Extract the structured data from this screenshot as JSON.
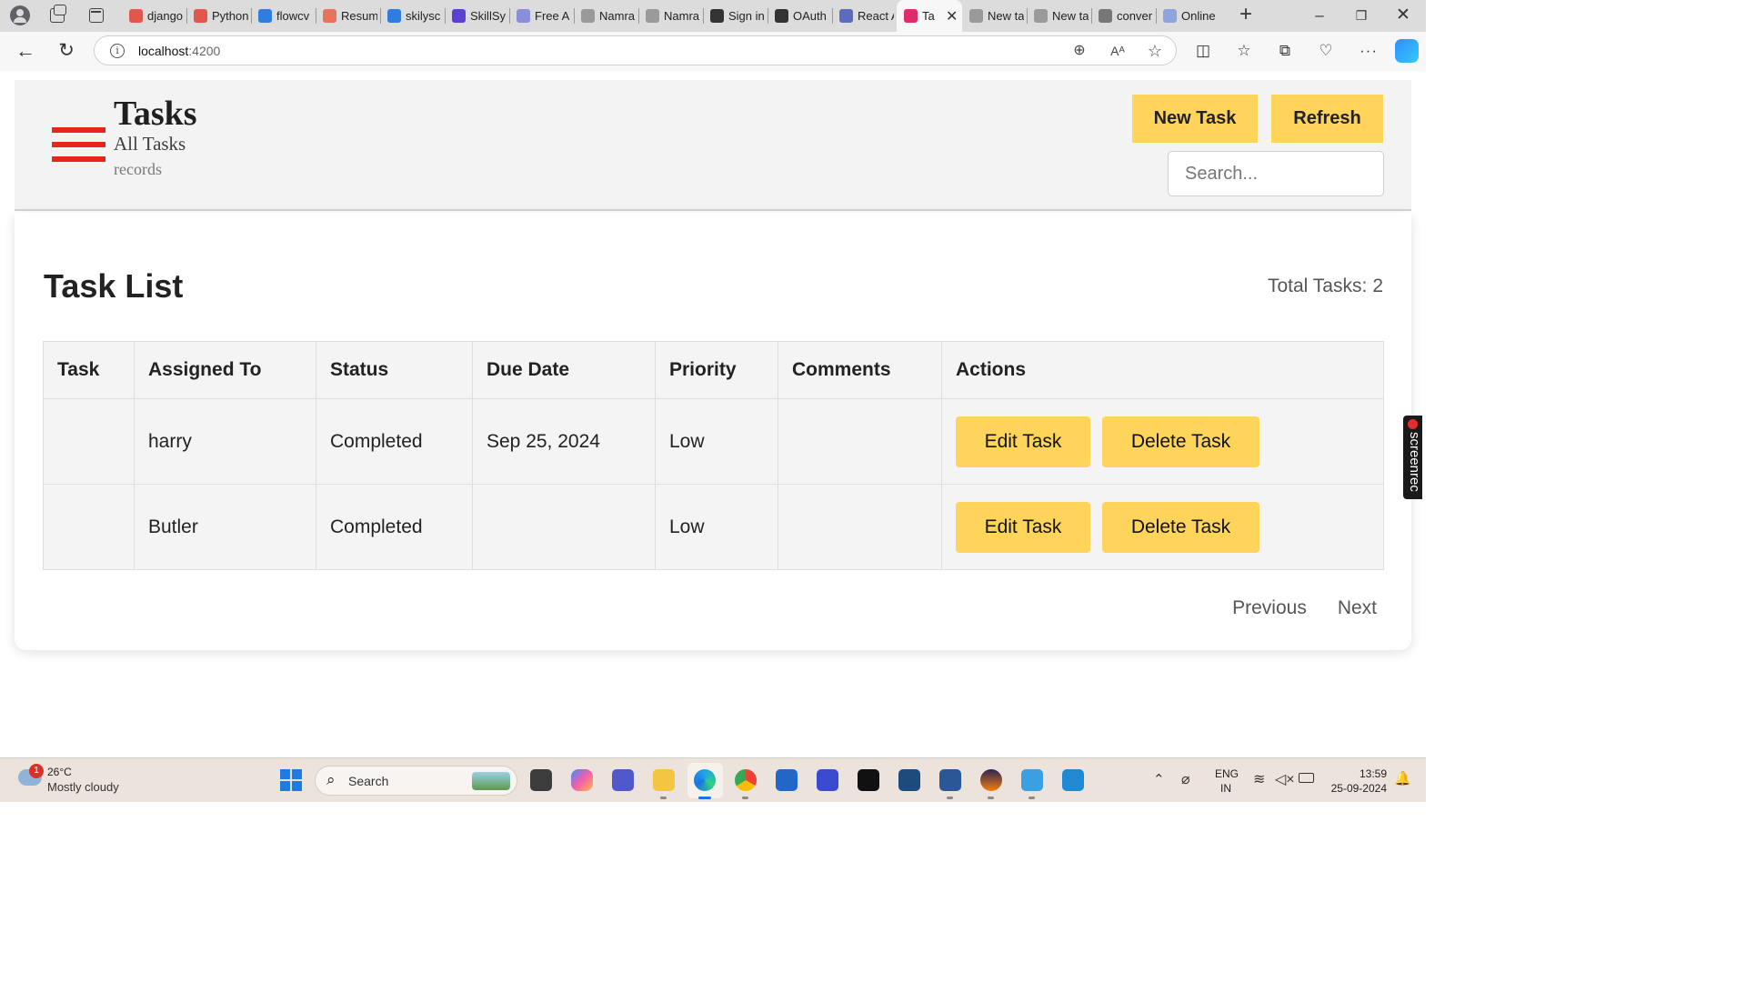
{
  "browser": {
    "tabs": [
      {
        "title": "django",
        "icon": "pdf-icon",
        "color": "#e1574c",
        "active": false
      },
      {
        "title": "Python",
        "icon": "pdf-icon",
        "color": "#e1574c",
        "active": false
      },
      {
        "title": "flowcv",
        "icon": "bing-icon",
        "color": "#2f7de1",
        "active": false
      },
      {
        "title": "Resum",
        "icon": "resume-icon",
        "color": "#e8735a",
        "active": false
      },
      {
        "title": "skilysc",
        "icon": "bing-icon",
        "color": "#2f7de1",
        "active": false
      },
      {
        "title": "SkillSy",
        "icon": "skillsyncer-icon",
        "color": "#5a3fd1",
        "active": false
      },
      {
        "title": "Free A",
        "icon": "r-icon",
        "color": "#8a8fd9",
        "active": false
      },
      {
        "title": "Namra",
        "icon": "document-icon",
        "color": "#9a9a9a",
        "active": false
      },
      {
        "title": "Namra",
        "icon": "document-icon",
        "color": "#9a9a9a",
        "active": false
      },
      {
        "title": "Sign in",
        "icon": "github-icon",
        "color": "#333333",
        "active": false
      },
      {
        "title": "OAuth",
        "icon": "github-icon",
        "color": "#333333",
        "active": false
      },
      {
        "title": "React A",
        "icon": "react-icon",
        "color": "#5c6bc0",
        "active": false
      },
      {
        "title": "Ta",
        "icon": "angular-icon",
        "color": "#dd2c6c",
        "active": true
      },
      {
        "title": "New ta",
        "icon": "newtab-icon",
        "color": "#9a9a9a",
        "active": false
      },
      {
        "title": "New ta",
        "icon": "newtab-icon",
        "color": "#9a9a9a",
        "active": false
      },
      {
        "title": "conver",
        "icon": "search-icon",
        "color": "#777777",
        "active": false
      },
      {
        "title": "Online",
        "icon": "online-icon",
        "color": "#8ea3e0",
        "active": false
      }
    ],
    "url": {
      "host": "localhost",
      "port": ":4200"
    }
  },
  "header": {
    "title": "Tasks",
    "subtitle": "All Tasks",
    "records": "records",
    "new_task_label": "New Task",
    "refresh_label": "Refresh",
    "search_placeholder": "Search...",
    "accent_color": "#ffd45a",
    "menu_color": "#e8261e"
  },
  "task_list": {
    "title": "Task List",
    "total_label": "Total Tasks:",
    "total_count": "2",
    "columns": [
      "Task",
      "Assigned To",
      "Status",
      "Due Date",
      "Priority",
      "Comments",
      "Actions"
    ],
    "rows": [
      {
        "task": "",
        "assigned_to": "harry",
        "status": "Completed",
        "due_date": "Sep 25, 2024",
        "priority": "Low",
        "comments": ""
      },
      {
        "task": "",
        "assigned_to": "Butler",
        "status": "Completed",
        "due_date": "",
        "priority": "Low",
        "comments": ""
      }
    ],
    "edit_label": "Edit Task",
    "delete_label": "Delete Task",
    "previous_label": "Previous",
    "next_label": "Next"
  },
  "overlay": {
    "label": "screenrec"
  },
  "taskbar": {
    "weather_badge": "1",
    "weather_temp": "26°C",
    "weather_desc": "Mostly cloudy",
    "search_label": "Search",
    "lang_line1": "ENG",
    "lang_line2": "IN",
    "time": "13:59",
    "date": "25-09-2024"
  }
}
